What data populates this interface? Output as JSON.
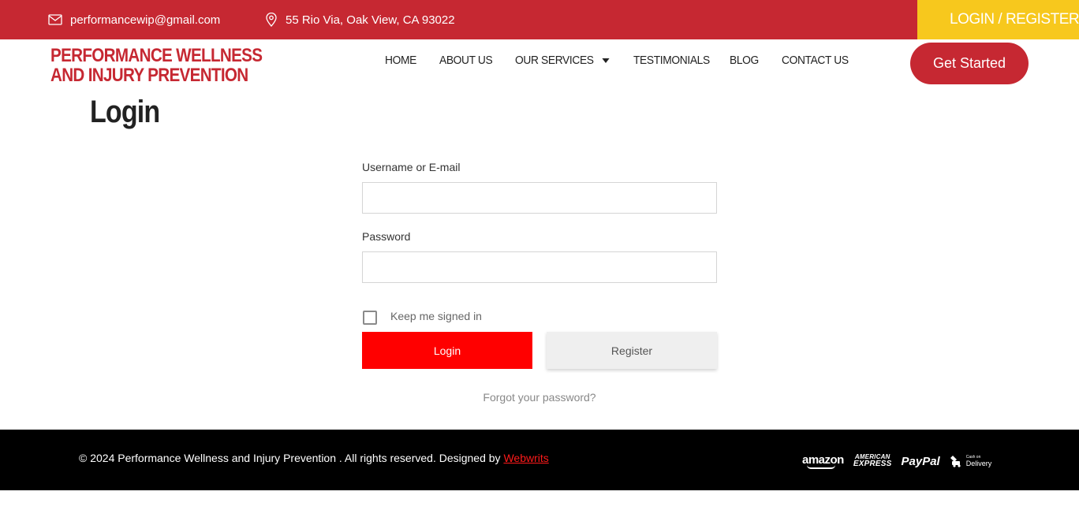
{
  "topbar": {
    "email": "performancewip@gmail.com",
    "address": "55 Rio Via, Oak View, CA 93022",
    "login_register": "LOGIN / REGISTER",
    "background_color": "#c62832",
    "accent_color": "#f7c81d"
  },
  "brand": {
    "line1": "PERFORMANCE WELLNESS",
    "line2": "AND INJURY PREVENTION"
  },
  "nav": {
    "items": [
      {
        "label": "HOME"
      },
      {
        "label": "ABOUT US"
      },
      {
        "label": "OUR SERVICES"
      },
      {
        "label": "TESTIMONIALS"
      },
      {
        "label": "BLOG"
      },
      {
        "label": "CONTACT US"
      }
    ],
    "cta": "Get Started"
  },
  "page": {
    "title": "Login"
  },
  "login_form": {
    "username_label": "Username or E-mail",
    "username_value": "",
    "password_label": "Password",
    "password_value": "",
    "remember_label": "Keep me signed in",
    "remember_checked": false,
    "login_button": "Login",
    "register_button": "Register",
    "forgot_link": "Forgot your password?",
    "login_button_color": "#ff0000"
  },
  "footer": {
    "copyright": "© 2024 Performance Wellness and Injury Prevention . All rights reserved. Designed by ",
    "designer_link": "Webwrits",
    "payments": {
      "amazon": "amazon",
      "amex_line1": "AMERICAN",
      "amex_line2": "EXPRESS",
      "paypal": "PayPal",
      "cod_small": "Cash on",
      "cod": "Delivery"
    }
  },
  "icons": {
    "email": "envelope-icon",
    "address": "map-pin-icon",
    "user": "user-icon",
    "dropdown": "caret-down-icon",
    "cod": "truck-icon"
  }
}
